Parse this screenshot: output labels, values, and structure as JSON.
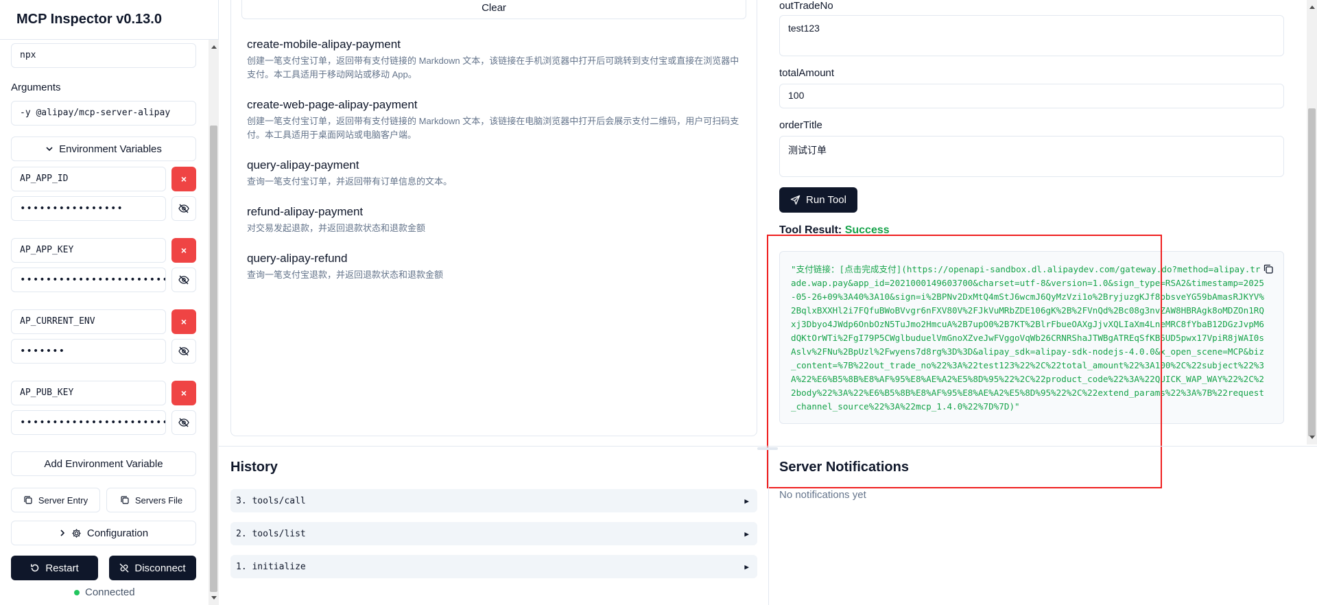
{
  "app": {
    "title": "MCP Inspector v0.13.0"
  },
  "sidebar": {
    "command_value": "npx",
    "arguments_label": "Arguments",
    "arguments_value": "-y @alipay/mcp-server-alipay",
    "env_toggle_label": "Environment Variables",
    "env_vars": [
      {
        "key": "AP_APP_ID",
        "masked_value": "••••••••••••••••"
      },
      {
        "key": "AP_APP_KEY",
        "masked_value": "••••••••••••••••••••••••••"
      },
      {
        "key": "AP_CURRENT_ENV",
        "masked_value": "•••••••"
      },
      {
        "key": "AP_PUB_KEY",
        "masked_value": "••••••••••••••••••••••••••"
      }
    ],
    "remove_label": "×",
    "add_env_label": "Add Environment Variable",
    "server_entry_label": "Server Entry",
    "servers_file_label": "Servers File",
    "configuration_label": "Configuration",
    "restart_label": "Restart",
    "disconnect_label": "Disconnect",
    "status_text": "Connected",
    "status_color": "#22c55e"
  },
  "tools": {
    "clear_label": "Clear",
    "items": [
      {
        "name": "create-mobile-alipay-payment",
        "description": "创建一笔支付宝订单，返回带有支付链接的 Markdown 文本，该链接在手机浏览器中打开后可跳转到支付宝或直接在浏览器中支付。本工具适用于移动网站或移动 App。"
      },
      {
        "name": "create-web-page-alipay-payment",
        "description": "创建一笔支付宝订单，返回带有支付链接的 Markdown 文本，该链接在电脑浏览器中打开后会展示支付二维码，用户可扫码支付。本工具适用于桌面网站或电脑客户端。"
      },
      {
        "name": "query-alipay-payment",
        "description": "查询一笔支付宝订单，并返回带有订单信息的文本。"
      },
      {
        "name": "refund-alipay-payment",
        "description": "对交易发起退款，并返回退款状态和退款金额"
      },
      {
        "name": "query-alipay-refund",
        "description": "查询一笔支付宝退款，并返回退款状态和退款金额"
      }
    ]
  },
  "form": {
    "fields": [
      {
        "label": "outTradeNo",
        "value": "test123"
      },
      {
        "label": "totalAmount",
        "value": "100"
      },
      {
        "label": "orderTitle",
        "value": "测试订单"
      }
    ],
    "run_label": "Run Tool",
    "result_label": "Tool Result:",
    "result_status": "Success",
    "result_text": "\"支付链接：[点击完成支付](https://openapi-sandbox.dl.alipaydev.com/gateway.do?method=alipay.trade.wap.pay&app_id=2021000149603700&charset=utf-8&version=1.0&sign_type=RSA2&timestamp=2025-05-26+09%3A40%3A10&sign=i%2BPNv2DxMtQ4mStJ6wcmJ6QyMzVzi1o%2BryjuzgKJf8bbsveYG59bAmasRJKYV%2BqlxBXXHl2i7FQfuBWoBVvgr6nFXV80V%2FJkVuMRbZDE106gK%2B%2FVnQd%2Bc08g3nvZAW8HBRAgk8oMDZOn1RQxj3Dbyo4JWdp6OnbOzN5TuJmo2HmcuA%2B7upO0%2B7KT%2BlrFbueOAXgJjvXQLIaXm4LneMRC8fYbaB12DGzJvpM6dQKtOrWTi%2FgI79P5CWglbuduelVmGnoXZveJwFVggoVqWb26CRNRShaJTWBgATREqSfKB5UD5pwx17VpiR8jWAI0sAslv%2FNu%2BpUzl%2Fwyens7d8rg%3D%3D&alipay_sdk=alipay-sdk-nodejs-4.0.0&x_open_scene=MCP&biz_content=%7B%22out_trade_no%22%3A%22test123%22%2C%22total_amount%22%3A100%2C%22subject%22%3A%22%E6%B5%8B%E8%AF%95%E8%AE%A2%E5%8D%95%22%2C%22product_code%22%3A%22QUICK_WAP_WAY%22%2C%22body%22%3A%22%E6%B5%8B%E8%AF%95%E8%AE%A2%E5%8D%95%22%2C%22extend_params%22%3A%7B%22request_channel_source%22%3A%22mcp_1.4.0%22%7D%7D)\""
  },
  "history": {
    "title": "History",
    "items": [
      "3. tools/call",
      "2. tools/list",
      "1. initialize"
    ],
    "expand_glyph": "▶"
  },
  "notifications": {
    "title": "Server Notifications",
    "empty_text": "No notifications yet"
  },
  "colors": {
    "accent_dark": "#0f172a",
    "danger": "#ef4444",
    "success": "#16a34a",
    "highlight_box": "#ef1d1d"
  }
}
